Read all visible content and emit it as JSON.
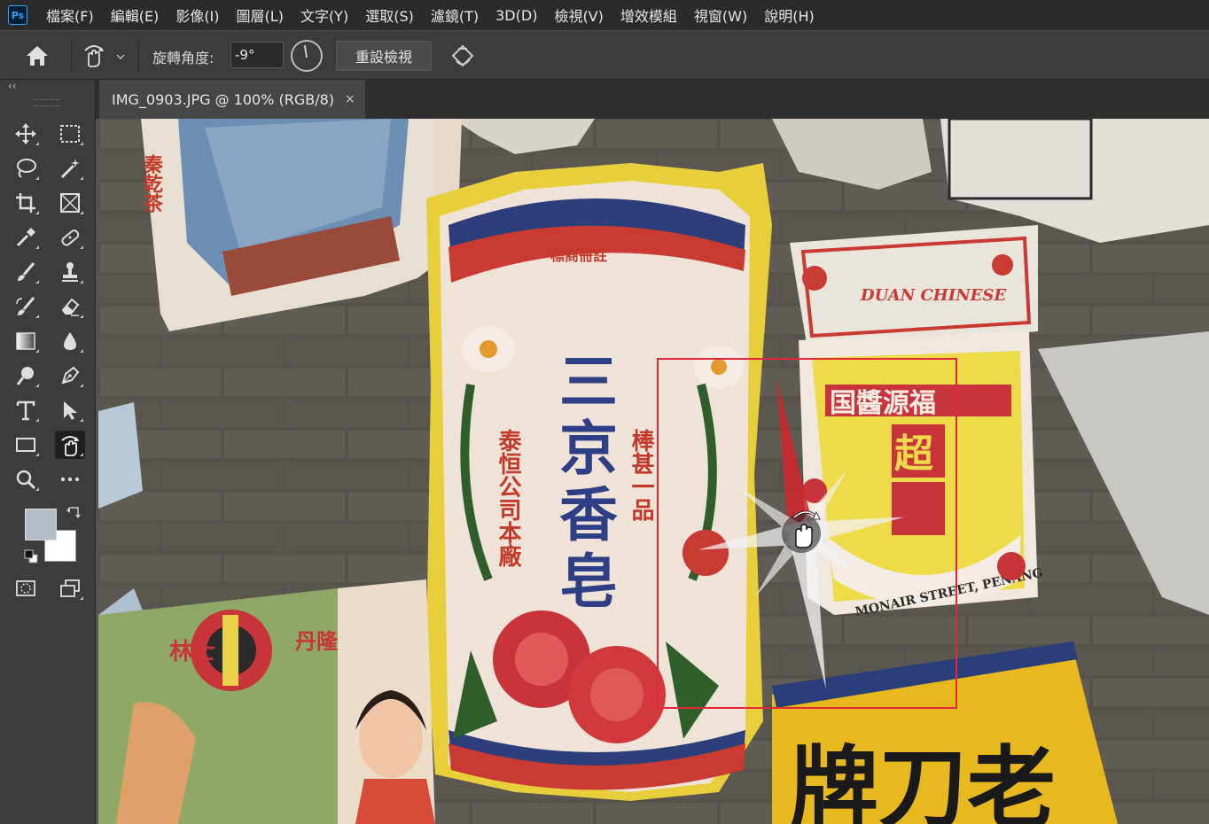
{
  "app": {
    "logo": "Ps",
    "menu": [
      "檔案(F)",
      "編輯(E)",
      "影像(I)",
      "圖層(L)",
      "文字(Y)",
      "選取(S)",
      "濾鏡(T)",
      "3D(D)",
      "檢視(V)",
      "增效模組",
      "視窗(W)",
      "說明(H)"
    ]
  },
  "options": {
    "rotate_label": "旋轉角度:",
    "rotate_value": "-9°",
    "reset_view_label": "重設檢視"
  },
  "toolpanel": {
    "collapse": "‹‹",
    "foreground_color": "#b4bcc6",
    "background_color": "#ffffff"
  },
  "document": {
    "tab_title": "IMG_0903.JPG @ 100% (RGB/8)",
    "close": "×"
  },
  "poster_text": {
    "center_main": [
      "三",
      "京",
      "香",
      "皂"
    ],
    "center_left": "泰恒公司本廠",
    "center_right": "棒甚一品",
    "center_top": "標商冊註",
    "right_header": "国醬源福",
    "right_big": "超",
    "right_bottom_en": "MONAIR STREET, PENANG",
    "right_top_en": "DUAN CHINESE",
    "bottom_right": "牌刀老",
    "bottom_left": "林士",
    "left_top_vertical": "秦乾茶",
    "left_red": "丹隆"
  }
}
